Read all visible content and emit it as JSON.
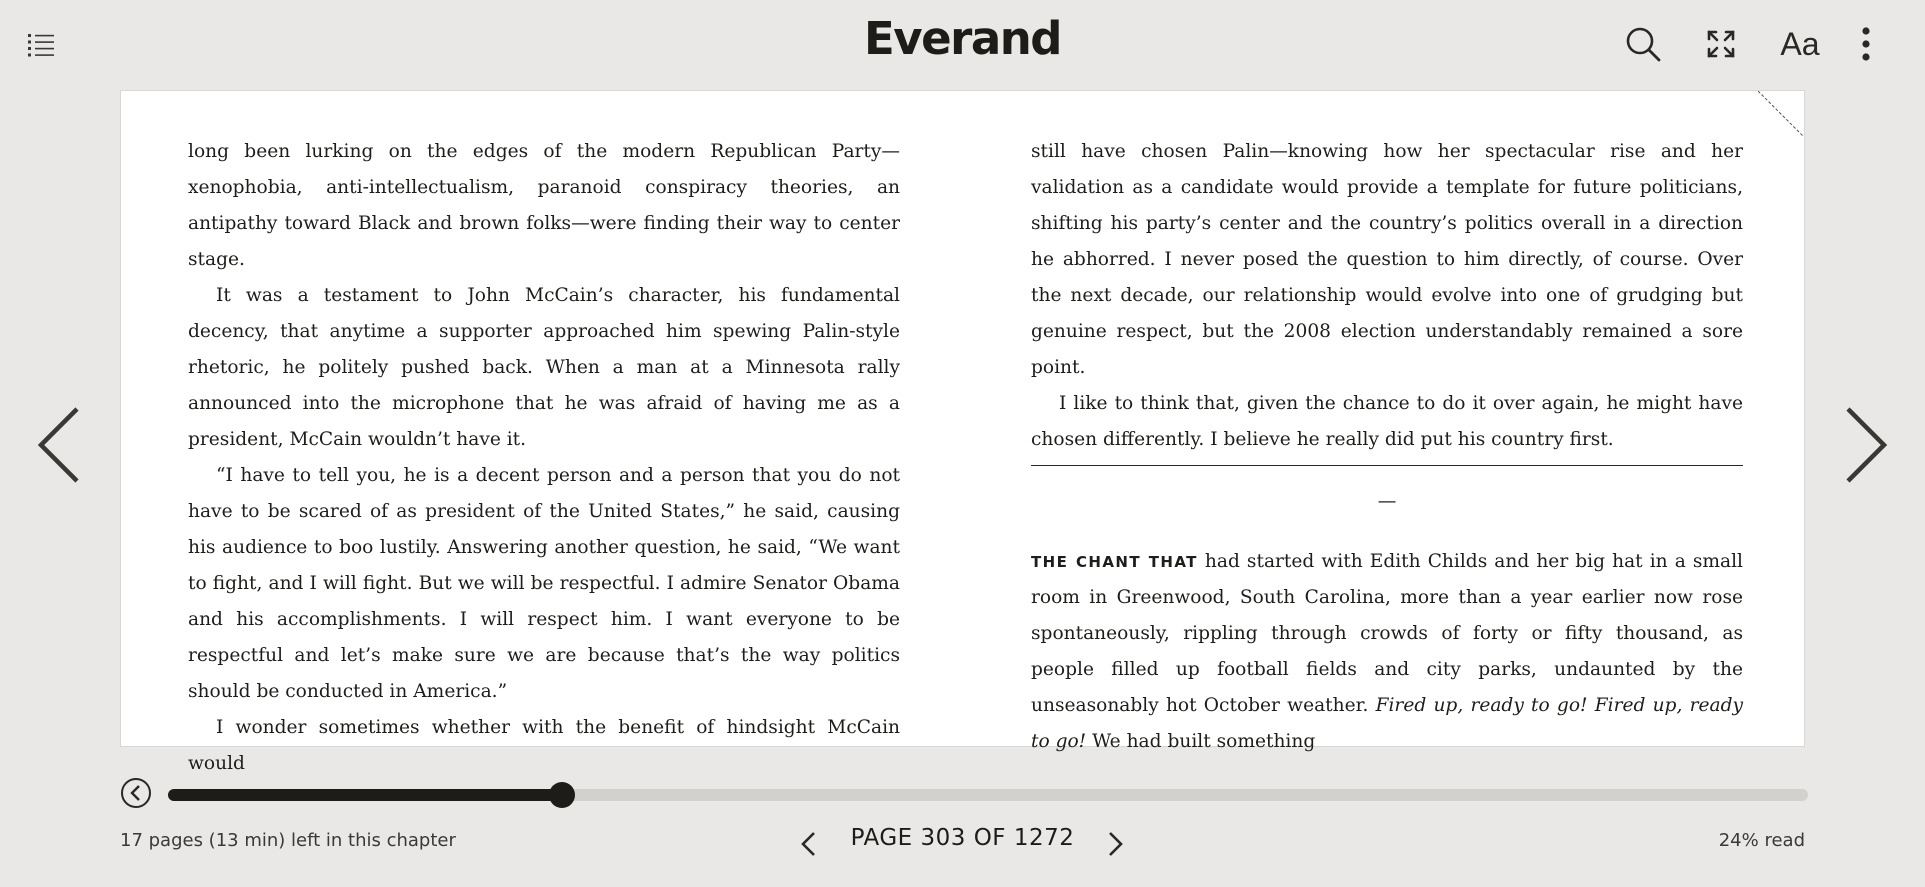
{
  "header": {
    "brand": "Everand",
    "toc_icon": "list-icon",
    "search_icon": "search-icon",
    "fullscreen_icon": "expand-icon",
    "font_settings_label": "Aa",
    "more_icon": "more-vertical-icon"
  },
  "reader": {
    "left_column": [
      "long been lurking on the edges of the modern Republican Party—xenophobia, anti-intellectualism, paranoid conspiracy theories, an antipathy toward Black and brown folks—were finding their way to center stage.",
      "It was a testament to John McCain’s character, his fundamental decency, that anytime a supporter approached him spewing Palin-style rhetoric, he politely pushed back. When a man at a Minnesota rally announced into the microphone that he was afraid of having me as a president, McCain wouldn’t have it.",
      "“I have to tell you, he is a decent person and a person that you do not have to be scared of as president of the United States,” he said, causing his audience to boo lustily. Answering another question, he said, “We want to fight, and I will fight. But we will be respectful. I admire Senator Obama and his accomplishments. I will respect him. I want everyone to be respectful and let’s make sure we are because that’s the way politics should be conducted in America.”",
      "I wonder sometimes whether with the benefit of hindsight McCain would"
    ],
    "right_column": {
      "para1": "still have chosen Palin—knowing how her spectacular rise and her validation as a candidate would provide a template for future politicians, shifting his party’s center and the country’s politics overall in a direction he abhorred. I never posed the question to him directly, of course. Over the next decade, our relationship would evolve into one of grudging but genuine respect, but the 2008 election understandably remained a sore point.",
      "para2": "I like to think that, given the chance to do it over again, he might have chosen differently. I believe he really did put his country first.",
      "section_break": "—",
      "lead_in": "THE CHANT THAT",
      "para3_a": " had started with Edith Childs and her big hat in a small room in Greenwood, South Carolina, more than a year earlier now rose spontaneously, rippling through crowds of forty or fifty thousand, as people filled up football fields and city parks, undaunted by the unseasonably hot October weather. ",
      "para3_italic": "Fired up, ready to go! Fired up, ready to go!",
      "para3_b": " We had built something"
    }
  },
  "navigation": {
    "prev_page_icon": "chevron-left-icon",
    "next_page_icon": "chevron-right-icon"
  },
  "progress": {
    "back_icon": "circle-back-icon",
    "fraction": 0.24
  },
  "footer": {
    "chapter_remaining": "17 pages (13 min) left in this chapter",
    "page_label": "PAGE 303 OF 1272",
    "percent_read": "24% read"
  }
}
